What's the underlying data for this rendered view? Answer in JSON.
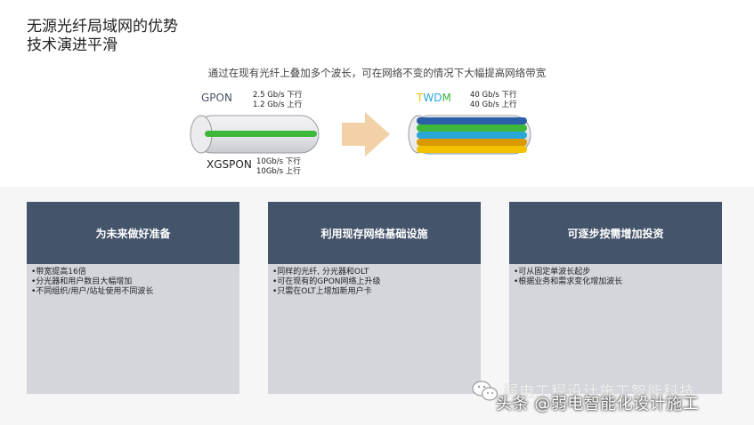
{
  "title_line1": "无源光纤局域网的优势",
  "title_line2": "技术演进平滑",
  "subtitle": "通过在现有光纤上叠加多个波长，可在网络不变的情况下大幅提高网络带宽",
  "gpon": {
    "label": "GPON",
    "down": "2.5 Gb/s 下行",
    "up": "1.2 Gb/s 上行"
  },
  "xgspon": {
    "label": "XGSPON",
    "down": "10Gb/s 下行",
    "up": "10Gb/s 上行"
  },
  "twdm": {
    "label_t": "T",
    "label_w": "W",
    "label_d": "D",
    "label_m": "M",
    "down": "40 Gb/s 下行",
    "up": "40 Gb/s 上行"
  },
  "cards": [
    {
      "title": "为未来做好准备",
      "items": [
        "•带宽提高16倍",
        "•分光器和用户数目大幅增加",
        "•不同组织/用户/站址使用不同波长"
      ]
    },
    {
      "title": "利用现存网络基础设施",
      "items": [
        "•同样的光纤, 分光器和OLT",
        "•可在现有的GPON网络上升级",
        "•只需在OLT上增加新用户卡"
      ]
    },
    {
      "title": "可逐步按需增加投资",
      "items": [
        "•可从固定单波长起步",
        "•根据业务和需求变化增加波长"
      ]
    }
  ],
  "watermark_back": "弱电工程设计施工智能科技",
  "watermark_front": "头条 @弱电智能化设计施工",
  "colors": {
    "card_header": "#44546a",
    "card_body": "#d4d6dc",
    "fiber_green": "#3db83a",
    "arrow": "#f2d1a8",
    "twdm_t": "#f2c200",
    "twdm_w": "#2aa7d9",
    "twdm_d": "#2aa7d9",
    "twdm_m": "#3db83a"
  }
}
